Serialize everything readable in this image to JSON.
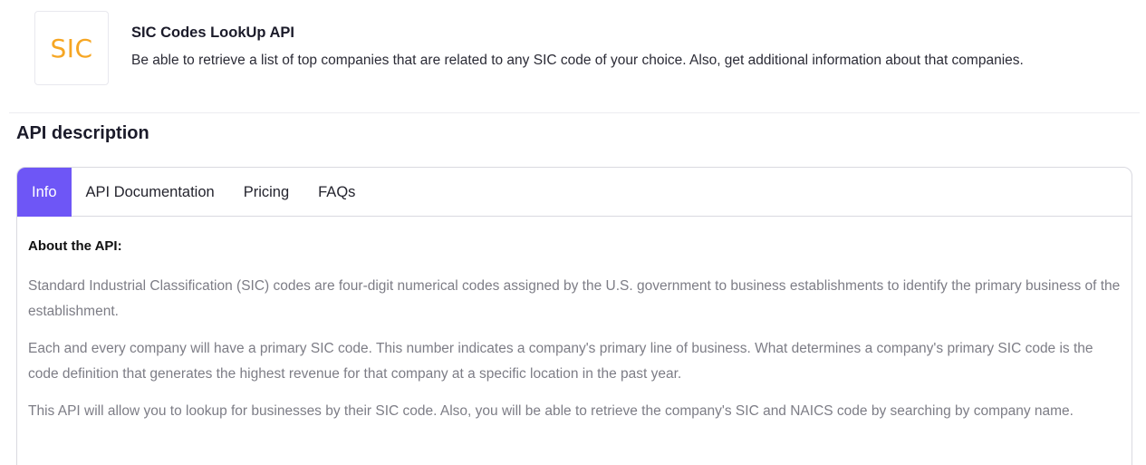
{
  "header": {
    "logo_text": "SIC",
    "title": "SIC Codes LookUp API",
    "subtitle": "Be able to retrieve a list of top companies that are related to any SIC code of your choice. Also, get additional information about that companies."
  },
  "section": {
    "title": "API description"
  },
  "tabs": [
    {
      "label": "Info",
      "active": true
    },
    {
      "label": "API Documentation",
      "active": false
    },
    {
      "label": "Pricing",
      "active": false
    },
    {
      "label": "FAQs",
      "active": false
    }
  ],
  "content": {
    "heading": "About the API:",
    "paragraphs": [
      "Standard Industrial Classification (SIC) codes are four-digit numerical codes assigned by the U.S. government to business establishments to identify the primary business of the establishment.",
      "Each and every company will have a primary SIC code. This number indicates a company's primary line of business. What determines a company's primary SIC code is the code definition that generates the highest revenue for that company at a specific location in the past year.",
      "This API will allow you to lookup for businesses by their SIC code. Also, you will be able to retrieve the company's SIC and NAICS code by searching by company name."
    ]
  },
  "colors": {
    "accent": "#6e56f6",
    "logo": "#f6a623",
    "body_text": "#7d7d86"
  }
}
